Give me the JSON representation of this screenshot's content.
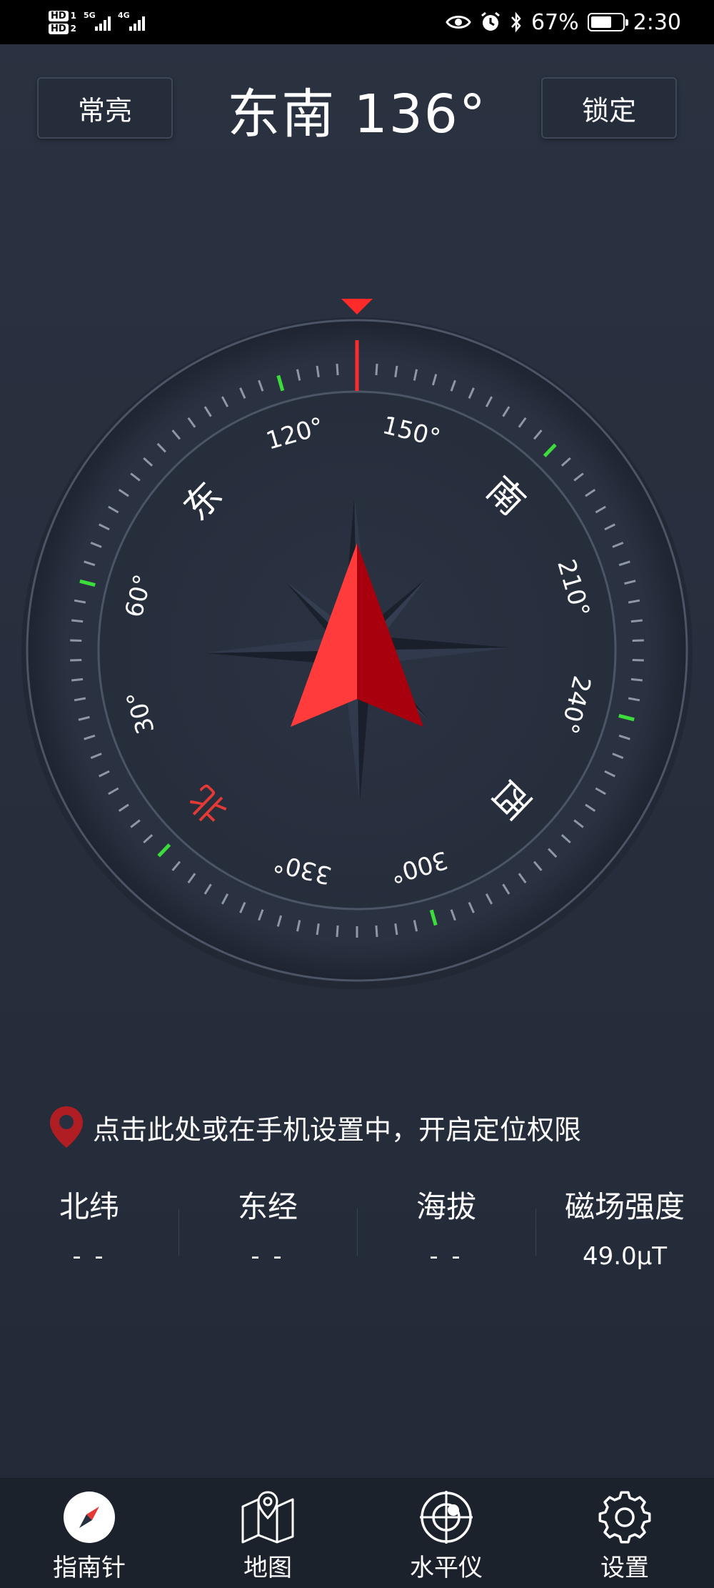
{
  "status_bar": {
    "hd1": "HD",
    "hd1_num": "1",
    "hd2": "HD",
    "hd2_num": "2",
    "net1": "5G",
    "net2": "4G",
    "battery_percent": "67%",
    "battery_level": 0.67,
    "time": "2:30",
    "icons": [
      "eye-icon",
      "alarm-icon",
      "bluetooth-icon",
      "battery-icon"
    ]
  },
  "header": {
    "left_button": "常亮",
    "heading": "东南  136°",
    "right_button": "锁定"
  },
  "compass": {
    "heading_degrees": 136,
    "cardinals": {
      "north": "北",
      "east": "东",
      "south": "南",
      "west": "西"
    },
    "degree_labels": [
      "30°",
      "60°",
      "120°",
      "150°",
      "210°",
      "240°",
      "300°",
      "330°"
    ],
    "colors": {
      "north": "#e53935",
      "needle_light": "#ff3b3b",
      "needle_dark": "#a8000c",
      "tick_green": "#3ddc3d",
      "pointer": "#ff2a2a"
    }
  },
  "location": {
    "hint": "点击此处或在手机设置中，开启定位权限",
    "pin_color": "#b01e24"
  },
  "info": [
    {
      "label": "北纬",
      "value": "- -"
    },
    {
      "label": "东经",
      "value": "- -"
    },
    {
      "label": "海拔",
      "value": "- -"
    },
    {
      "label": "磁场强度",
      "value": "49.0μT"
    }
  ],
  "nav": [
    {
      "label": "指南针",
      "icon": "compass-icon"
    },
    {
      "label": "地图",
      "icon": "map-icon"
    },
    {
      "label": "水平仪",
      "icon": "level-icon"
    },
    {
      "label": "设置",
      "icon": "gear-icon"
    }
  ]
}
